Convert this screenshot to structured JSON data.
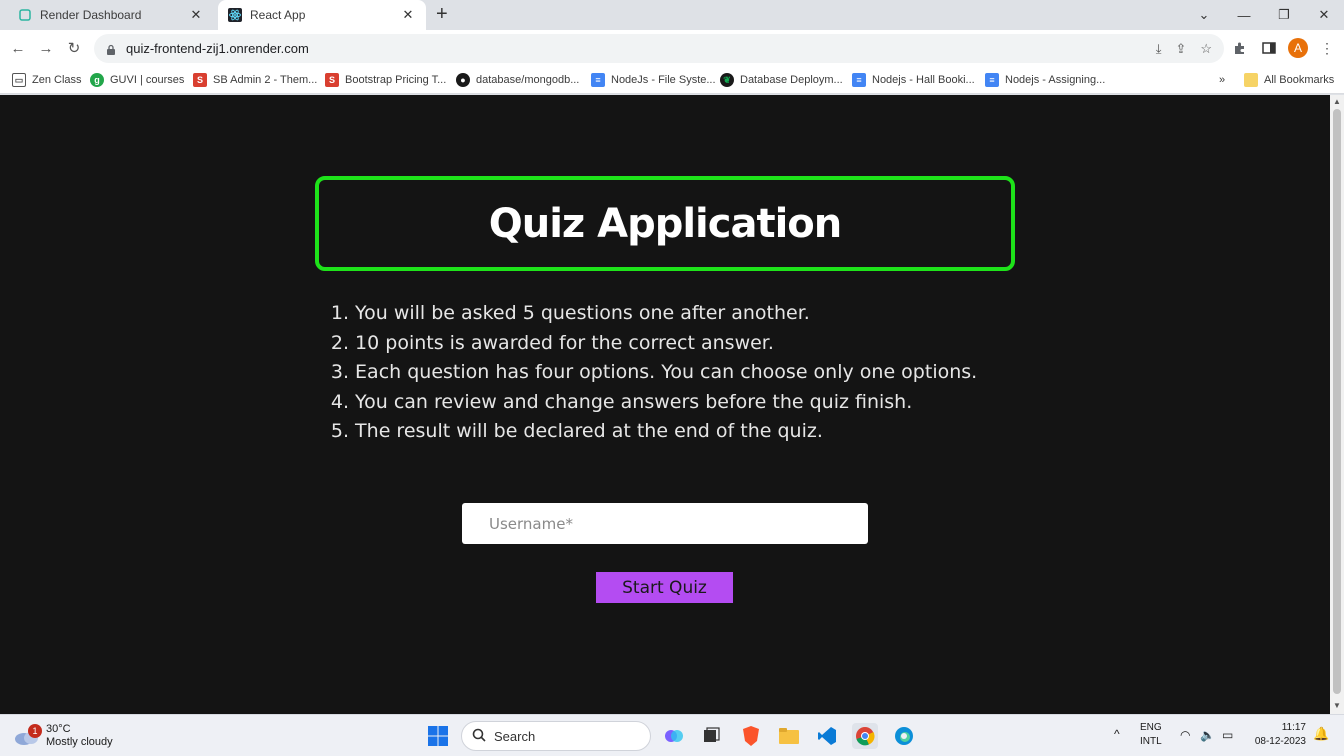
{
  "browser": {
    "tabs": [
      {
        "title": "Render Dashboard",
        "active": false
      },
      {
        "title": "React App",
        "active": true
      }
    ],
    "address": "quiz-frontend-zij1.onrender.com",
    "profile_initial": "A",
    "bookmarks": [
      {
        "label": "Zen Class",
        "icon": "zen-class-icon",
        "color": "#555555"
      },
      {
        "label": "GUVI | courses",
        "icon": "guvi-icon",
        "color": "#22a64a"
      },
      {
        "label": "SB Admin 2 - Them...",
        "icon": "sb-admin-icon",
        "color": "#d93f30"
      },
      {
        "label": "Bootstrap Pricing T...",
        "icon": "bootstrap-icon",
        "color": "#d93f30"
      },
      {
        "label": "database/mongodb...",
        "icon": "github-icon",
        "color": "#1a1a1a"
      },
      {
        "label": "NodeJs - File Syste...",
        "icon": "docs-icon",
        "color": "#4285f4"
      },
      {
        "label": "Database Deploym...",
        "icon": "mongodb-icon",
        "color": "#13aa52"
      },
      {
        "label": "Nodejs - Hall Booki...",
        "icon": "docs-icon",
        "color": "#4285f4"
      },
      {
        "label": "Nodejs - Assigning...",
        "icon": "docs-icon",
        "color": "#4285f4"
      }
    ],
    "overflow": "»",
    "all_bookmarks": "All Bookmarks"
  },
  "app": {
    "title": "Quiz Application",
    "rules": [
      {
        "num": "1.",
        "text": "You will be asked 5 questions one after another."
      },
      {
        "num": "2.",
        "text": "10 points is awarded for the correct answer."
      },
      {
        "num": "3.",
        "text": "Each question has four options. You can choose only one options."
      },
      {
        "num": "4.",
        "text": "You can review and change answers before the quiz finish."
      },
      {
        "num": "5.",
        "text": "The result will be declared at the end of the quiz."
      }
    ],
    "username_placeholder": "Username*",
    "username_value": "",
    "start_label": "Start Quiz",
    "accent_border": "#1ee31a",
    "button_color": "#b44cf2"
  },
  "taskbar": {
    "weather_temp": "30°C",
    "weather_desc": "Mostly cloudy",
    "notification_count": "1",
    "search_label": "Search",
    "lang_top": "ENG",
    "lang_bottom": "INTL",
    "time": "11:17",
    "date": "08-12-2023"
  }
}
